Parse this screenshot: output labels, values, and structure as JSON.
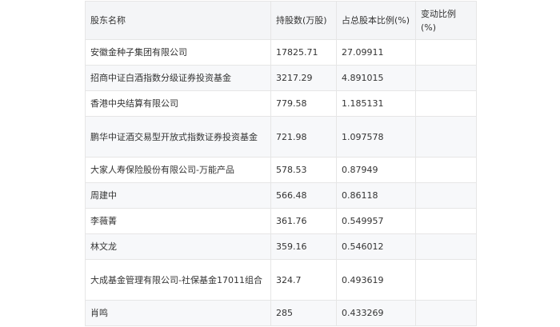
{
  "table": {
    "headers": {
      "name": "股东名称",
      "shares": "持股数(万股)",
      "ratio": "占总股本比例(%)",
      "change": "变动比例(%)"
    },
    "rows": [
      {
        "name": "安徽金种子集团有限公司",
        "shares": "17825.71",
        "ratio": "27.09911",
        "change": ""
      },
      {
        "name": "招商中证白酒指数分级证券投资基金",
        "shares": "3217.29",
        "ratio": "4.891015",
        "change": ""
      },
      {
        "name": "香港中央结算有限公司",
        "shares": "779.58",
        "ratio": "1.185131",
        "change": ""
      },
      {
        "name": "鹏华中证酒交易型开放式指数证券投资基金",
        "shares": "721.98",
        "ratio": "1.097578",
        "change": ""
      },
      {
        "name": "大家人寿保险股份有限公司-万能产品",
        "shares": "578.53",
        "ratio": "0.87949",
        "change": ""
      },
      {
        "name": "周建中",
        "shares": "566.48",
        "ratio": "0.86118",
        "change": ""
      },
      {
        "name": "李薇菁",
        "shares": "361.76",
        "ratio": "0.549957",
        "change": ""
      },
      {
        "name": "林文龙",
        "shares": "359.16",
        "ratio": "0.546012",
        "change": ""
      },
      {
        "name": "大成基金管理有限公司-社保基金17011组合",
        "shares": "324.7",
        "ratio": "0.493619",
        "change": ""
      },
      {
        "name": "肖鸣",
        "shares": "285",
        "ratio": "0.433269",
        "change": ""
      }
    ]
  }
}
